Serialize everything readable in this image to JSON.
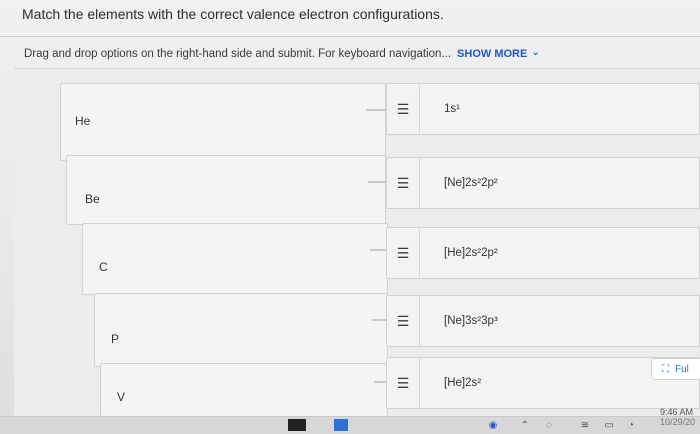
{
  "question": {
    "title": "Match the elements with the correct valence electron configurations.",
    "instructions": "Drag and drop options on the right-hand side and submit. For keyboard navigation...",
    "show_more": "SHOW MORE"
  },
  "elements": [
    "He",
    "Be",
    "C",
    "P",
    "V"
  ],
  "answers": [
    "1s¹",
    "[Ne]2s²2p²",
    "[He]2s²2p²",
    "[Ne]3s²3p³",
    "[He]2s²"
  ],
  "icons": {
    "drag_handle": "drag-handle-icon",
    "show_more": "chevron-down-icon",
    "fullscreen": "fullscreen-icon"
  },
  "fullscreen_label": "Ful",
  "clock": {
    "time": "9:46 AM",
    "date": "10/29/20"
  },
  "colors": {
    "link_blue": "#1f57c9",
    "background": "#e9e9ec"
  }
}
